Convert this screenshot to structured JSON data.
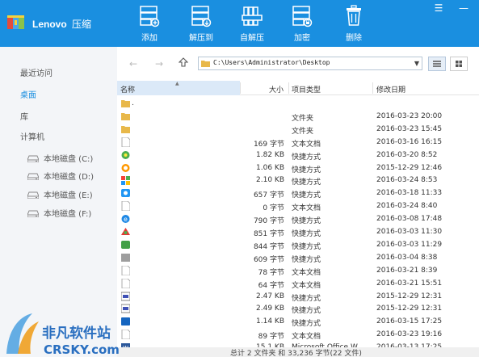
{
  "app": {
    "brand": "Lenovo",
    "title_suffix": "压缩"
  },
  "toolbar": [
    {
      "label": "添加",
      "icon": "add-archive-icon"
    },
    {
      "label": "解压到",
      "icon": "extract-to-icon"
    },
    {
      "label": "自解压",
      "icon": "self-extract-icon"
    },
    {
      "label": "加密",
      "icon": "encrypt-icon"
    },
    {
      "label": "删除",
      "icon": "delete-icon"
    }
  ],
  "window_controls": {
    "menu": "☰",
    "minimize": "—"
  },
  "sidebar": {
    "recent": "最近访问",
    "desktop": "桌面",
    "library": "库",
    "computer": "计算机",
    "disks": [
      {
        "label": "本地磁盘 (C:)"
      },
      {
        "label": "本地磁盘 (D:)"
      },
      {
        "label": "本地磁盘 (E:)"
      },
      {
        "label": "本地磁盘 (F:)"
      }
    ]
  },
  "address": {
    "path": "C:\\Users\\Administrator\\Desktop"
  },
  "columns": {
    "name": "名称",
    "size": "大小",
    "type": "项目类型",
    "date": "修改日期"
  },
  "files": [
    {
      "name": ".",
      "size": "",
      "type": "",
      "date": "",
      "icon": "folder"
    },
    {
      "name": "",
      "size": "",
      "type": "文件夹",
      "date": "2016-03-23 20:00",
      "icon": "folder"
    },
    {
      "name": "",
      "size": "",
      "type": "文件夹",
      "date": "2016-03-23 15:45",
      "icon": "folder"
    },
    {
      "name": "",
      "size": "169 字节",
      "type": "文本文档",
      "date": "2016-03-16 16:15",
      "icon": "txt"
    },
    {
      "name": "",
      "size": "1.82 KB",
      "type": "快捷方式",
      "date": "2016-03-20 8:52",
      "icon": "green"
    },
    {
      "name": "",
      "size": "1.06 KB",
      "type": "快捷方式",
      "date": "2015-12-29 12:46",
      "icon": "orange"
    },
    {
      "name": "",
      "size": "2.10 KB",
      "type": "快捷方式",
      "date": "2016-03-24 8:53",
      "icon": "multi"
    },
    {
      "name": "",
      "size": "657 字节",
      "type": "快捷方式",
      "date": "2016-03-18 11:33",
      "icon": "blue"
    },
    {
      "name": "",
      "size": "0 字节",
      "type": "文本文档",
      "date": "2016-03-24 8:40",
      "icon": "txt"
    },
    {
      "name": "",
      "size": "790 字节",
      "type": "快捷方式",
      "date": "2016-03-08 17:48",
      "icon": "ie"
    },
    {
      "name": "",
      "size": "851 字节",
      "type": "快捷方式",
      "date": "2016-03-03 11:30",
      "icon": "red"
    },
    {
      "name": "",
      "size": "844 字节",
      "type": "快捷方式",
      "date": "2016-03-03 11:29",
      "icon": "green2"
    },
    {
      "name": "",
      "size": "609 字节",
      "type": "快捷方式",
      "date": "2016-03-04 8:38",
      "icon": "gray"
    },
    {
      "name": "",
      "size": "78 字节",
      "type": "文本文档",
      "date": "2016-03-21 8:39",
      "icon": "txt"
    },
    {
      "name": "",
      "size": "64 字节",
      "type": "文本文档",
      "date": "2016-03-21 15:51",
      "icon": "txt"
    },
    {
      "name": "",
      "size": "2.47 KB",
      "type": "快捷方式",
      "date": "2015-12-29 12:31",
      "icon": "exe"
    },
    {
      "name": "",
      "size": "2.49 KB",
      "type": "快捷方式",
      "date": "2015-12-29 12:31",
      "icon": "exe"
    },
    {
      "name": "",
      "size": "1.14 KB",
      "type": "快捷方式",
      "date": "2016-03-15 17:25",
      "icon": "blue2"
    },
    {
      "name": "",
      "size": "89 字节",
      "type": "文本文档",
      "date": "2016-03-23 19:16",
      "icon": "txt"
    },
    {
      "name": "",
      "size": "15.1 KB",
      "type": "Microsoft Office W",
      "date": "2016-03-13 17:25",
      "icon": "word"
    }
  ],
  "status": {
    "text": "总计 2 文件夹 和 33,236 字节(22 文件)"
  },
  "watermark": {
    "line1": "非凡软件站",
    "line2": "CRSKY.com"
  },
  "colors": {
    "accent": "#1a8fe0",
    "sidebar_bg": "#f3f5f8"
  }
}
